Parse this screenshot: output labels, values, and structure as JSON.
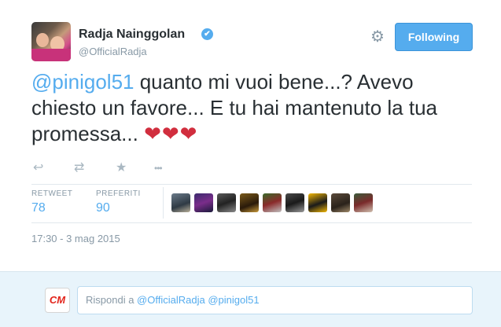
{
  "user": {
    "name": "Radja Nainggolan",
    "handle": "@OfficialRadja",
    "verified_glyph": "✔"
  },
  "follow_button": {
    "label": "Following",
    "color": "#55acee"
  },
  "tweet": {
    "mention": "@pinigol51",
    "body": " quanto mi vuoi bene...? Avevo chiesto un favore... E tu hai mantenuto la tua promessa... ",
    "hearts": "❤❤❤",
    "timestamp": "17:30 - 3 mag 2015"
  },
  "actions": [
    {
      "icon": "reply-icon",
      "glyph": "↩"
    },
    {
      "icon": "retweet-icon",
      "glyph": "⇄"
    },
    {
      "icon": "favorite-star-icon",
      "glyph": "★"
    },
    {
      "icon": "more-icon",
      "glyph": "•••"
    }
  ],
  "stats": {
    "retweets_label": "RETWEET",
    "retweets_value": "78",
    "favorites_label": "PREFERITI",
    "favorites_value": "90"
  },
  "favoriters": [
    {
      "icon": "favoriter-avatar-1"
    },
    {
      "icon": "favoriter-avatar-2"
    },
    {
      "icon": "favoriter-avatar-3"
    },
    {
      "icon": "favoriter-avatar-4"
    },
    {
      "icon": "favoriter-avatar-5"
    },
    {
      "icon": "favoriter-avatar-6"
    },
    {
      "icon": "favoriter-avatar-7"
    },
    {
      "icon": "favoriter-avatar-8"
    },
    {
      "icon": "favoriter-avatar-9"
    }
  ],
  "reply": {
    "prefix": "Rispondi a ",
    "mention1": "@OfficialRadja",
    "mention2": "@pinigol51",
    "logo_text": "CM"
  },
  "colors": {
    "accent": "#55acee",
    "heart": "#d12e3e",
    "muted": "#8899a6"
  }
}
